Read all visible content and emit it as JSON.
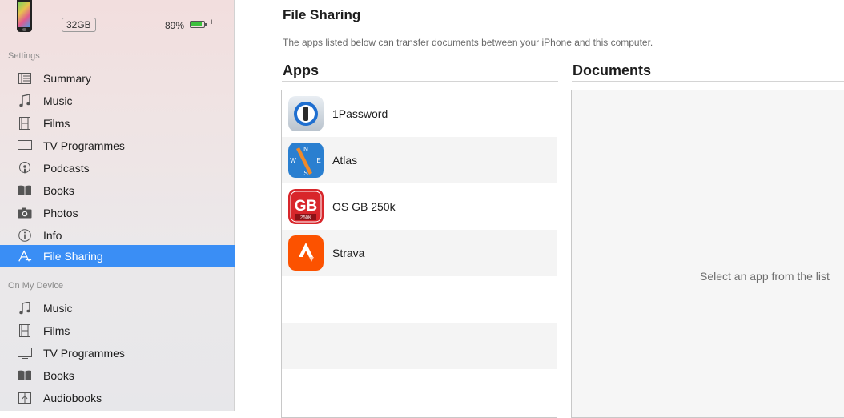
{
  "device": {
    "capacity": "32GB",
    "battery_percent_label": "89%",
    "battery_level": 0.89,
    "charging_glyph": "+"
  },
  "sidebar": {
    "settings_label": "Settings",
    "settings_items": [
      {
        "label": "Summary",
        "icon": "summary-icon"
      },
      {
        "label": "Music",
        "icon": "music-note-icon"
      },
      {
        "label": "Films",
        "icon": "film-icon"
      },
      {
        "label": "TV Programmes",
        "icon": "tv-icon"
      },
      {
        "label": "Podcasts",
        "icon": "podcast-icon"
      },
      {
        "label": "Books",
        "icon": "book-icon"
      },
      {
        "label": "Photos",
        "icon": "camera-icon"
      },
      {
        "label": "Info",
        "icon": "info-icon"
      },
      {
        "label": "File Sharing",
        "icon": "file-sharing-icon",
        "selected": true
      }
    ],
    "on_device_label": "On My Device",
    "on_device_items": [
      {
        "label": "Music",
        "icon": "music-note-icon"
      },
      {
        "label": "Films",
        "icon": "film-icon"
      },
      {
        "label": "TV Programmes",
        "icon": "tv-icon"
      },
      {
        "label": "Books",
        "icon": "book-icon"
      },
      {
        "label": "Audiobooks",
        "icon": "audiobook-icon"
      }
    ]
  },
  "main": {
    "title": "File Sharing",
    "description": "The apps listed below can transfer documents between your iPhone and this computer.",
    "apps_header": "Apps",
    "documents_header": "Documents",
    "apps": [
      {
        "name": "1Password",
        "icon": "1password-app-icon"
      },
      {
        "name": "Atlas",
        "icon": "atlas-app-icon"
      },
      {
        "name": "OS GB 250k",
        "icon": "osgb-app-icon",
        "icon_text": "GB",
        "icon_subtext": "250K"
      },
      {
        "name": "Strava",
        "icon": "strava-app-icon"
      }
    ],
    "documents_empty_text": "Select an app from the list"
  },
  "colors": {
    "selection": "#3a8ef5",
    "strava": "#fc5200",
    "osgb_red": "#d8262b",
    "atlas_blue": "#2a7fd0"
  }
}
